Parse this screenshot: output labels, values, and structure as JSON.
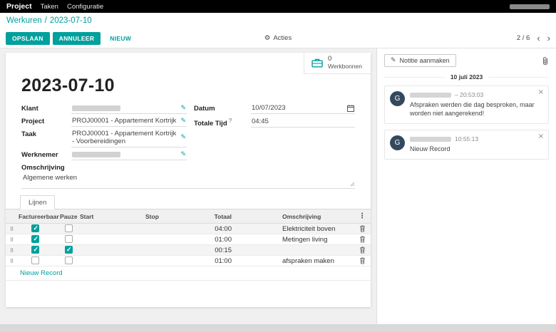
{
  "colors": {
    "accent": "#00a09d",
    "avatar": "#35495e"
  },
  "icons": {
    "gear": "⚙",
    "edit": "✎",
    "chevron_left": "‹",
    "chevron_right": "›",
    "close": "×",
    "dots": "⋮",
    "drag": "⠿"
  },
  "topbar": {
    "app_label": "Project",
    "menus": [
      "Taken",
      "Configuratie"
    ]
  },
  "breadcrumb": {
    "parent": "Werkuren",
    "separator": "/",
    "current": "2023-07-10"
  },
  "control_panel": {
    "save": "OPSLAAN",
    "discard": "ANNULEER",
    "new": "NIEUW",
    "actions": "Acties",
    "pager_value": "2 / 6"
  },
  "form": {
    "stat_button": {
      "count": "0",
      "label": "Werkbonnen"
    },
    "title": "2023-07-10",
    "fields": {
      "klant": {
        "label": "Klant"
      },
      "project": {
        "label": "Project",
        "value": "PROJ00001 - Appartement Kortrijk"
      },
      "taak": {
        "label": "Taak",
        "value": "PROJ00001 - Appartement Kortrijk - Voorbereidingen"
      },
      "werknemer": {
        "label": "Werknemer"
      },
      "datum": {
        "label": "Datum",
        "value": "10/07/2023"
      },
      "totale_tijd": {
        "label": "Totale Tijd",
        "help": "?",
        "value": "04:45"
      },
      "omschrijving": {
        "label": "Omschrijving",
        "value": "Algemene werken"
      }
    },
    "tab": "Lijnen",
    "table": {
      "headers": [
        "Factureerbaar",
        "Pauze",
        "Start",
        "Stop",
        "Totaal",
        "Omschrijving"
      ],
      "rows": [
        {
          "facturerbaar": true,
          "pauze": false,
          "start": "",
          "stop": "",
          "totaal": "04:00",
          "omschrijving": "Elektriciteit boven"
        },
        {
          "facturerbaar": true,
          "pauze": false,
          "start": "",
          "stop": "",
          "totaal": "01:00",
          "omschrijving": "Metingen living"
        },
        {
          "facturerbaar": true,
          "pauze": true,
          "start": "",
          "stop": "",
          "totaal": "00:15",
          "omschrijving": ""
        },
        {
          "facturerbaar": false,
          "pauze": false,
          "start": "",
          "stop": "",
          "totaal": "01:00",
          "omschrijving": "afspraken maken"
        }
      ],
      "new_record_label": "Nieuw Record"
    }
  },
  "chatter": {
    "note_button": "Notitie aanmaken",
    "date_divider": "10 juli 2023",
    "messages": [
      {
        "avatar": "G",
        "time": "– 20:53:03",
        "body": "Afspraken werden die dag besproken, maar worden niet aangerekend!"
      },
      {
        "avatar": "G",
        "time": "10:55:13",
        "body": "Nieuw Record"
      }
    ]
  }
}
